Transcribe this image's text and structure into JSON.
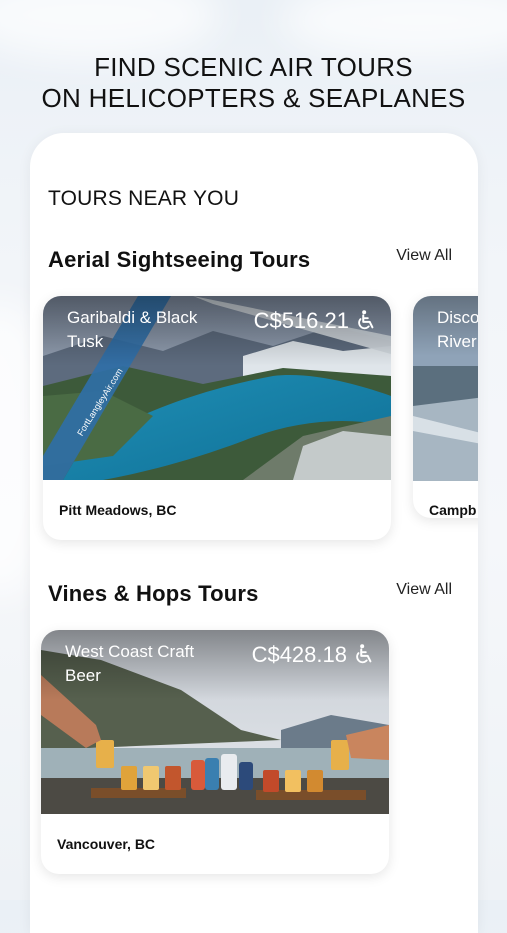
{
  "headline": {
    "line1": "FIND SCENIC AIR TOURS",
    "line2": "ON HELICOPTERS & SEAPLANES"
  },
  "tours_near": "TOURS NEAR YOU",
  "sections": [
    {
      "title": "Aerial Sightseeing Tours",
      "view_all": "View All",
      "cards": [
        {
          "name": "Garibaldi & Black Tusk",
          "price": "C$516.21",
          "location": "Pitt Meadows, BC",
          "accessible_icon": "wheelchair-icon",
          "image_watermark": "FortLangleyAir.com"
        },
        {
          "name": "Disco River",
          "location": "Campb"
        }
      ]
    },
    {
      "title": "Vines & Hops Tours",
      "view_all": "View All",
      "cards": [
        {
          "name": "West Coast Craft Beer",
          "price": "C$428.18",
          "location": "Vancouver, BC",
          "accessible_icon": "wheelchair-icon"
        }
      ]
    }
  ]
}
